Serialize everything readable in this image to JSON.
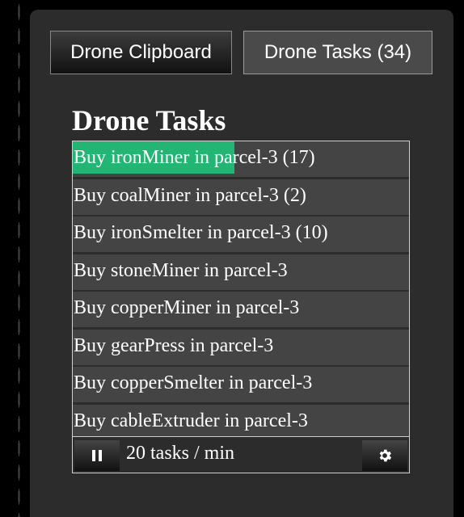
{
  "tabs": [
    {
      "label": "Drone Clipboard",
      "active": false
    },
    {
      "label": "Drone Tasks (34)",
      "active": true
    }
  ],
  "heading": "Drone Tasks",
  "tasks": [
    {
      "label": "Buy ironMiner in parcel-3 (17)",
      "progress": 0.48
    },
    {
      "label": "Buy coalMiner in parcel-3 (2)",
      "progress": 0
    },
    {
      "label": "Buy ironSmelter in parcel-3 (10)",
      "progress": 0
    },
    {
      "label": "Buy stoneMiner in parcel-3",
      "progress": 0
    },
    {
      "label": "Buy copperMiner in parcel-3",
      "progress": 0
    },
    {
      "label": "Buy gearPress in parcel-3",
      "progress": 0
    },
    {
      "label": "Buy copperSmelter in parcel-3",
      "progress": 0
    },
    {
      "label": "Buy cableExtruder in parcel-3",
      "progress": 0
    }
  ],
  "footer": {
    "rate_label": "20 tasks / min",
    "pause_icon": "pause-icon",
    "settings_icon": "gear-icon"
  },
  "colors": {
    "progress": "#22b573",
    "panel": "#2c2c2c",
    "row": "#444444"
  }
}
